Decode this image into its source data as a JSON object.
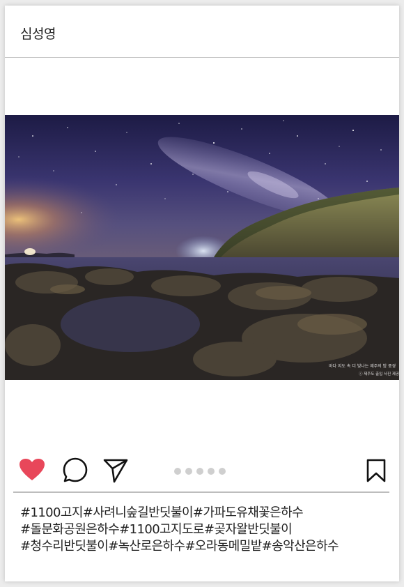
{
  "post": {
    "username": "심성영",
    "image": {
      "watermark_line1": "바다 지도 속 더 빛나는 제주의 밤 풍경",
      "watermark_line2": "ⓒ 제주도 출입 사진 제공"
    },
    "actions": {
      "like_icon": "heart-icon",
      "comment_icon": "speech-bubble-icon",
      "share_icon": "paper-plane-icon",
      "save_icon": "bookmark-icon",
      "like_color": "#e8475a",
      "carousel_dot_count": 5
    },
    "caption_lines": [
      "#1100고지#사려니숲길반딧불이#가파도유채꽃은하수",
      "#돌문화공원은하수#1100고지도로#곶자왈반딧불이",
      "#청수리반딧불이#녹산로은하수#오라동메밀밭#송악산은하수"
    ]
  }
}
